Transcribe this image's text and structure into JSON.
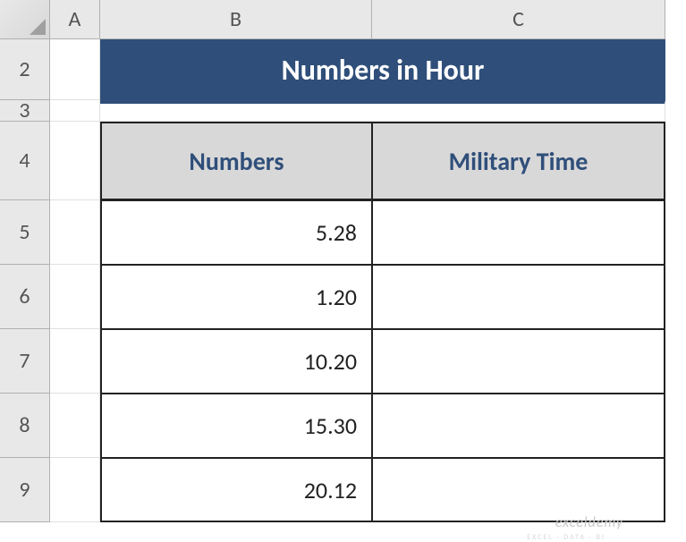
{
  "columns": [
    "A",
    "B",
    "C"
  ],
  "rows": [
    "2",
    "3",
    "4",
    "5",
    "6",
    "7",
    "8",
    "9"
  ],
  "title": "Numbers in Hour",
  "headers": {
    "col_b": "Numbers",
    "col_c": "Military Time"
  },
  "chart_data": {
    "type": "table",
    "columns": [
      "Numbers",
      "Military Time"
    ],
    "rows": [
      {
        "Numbers": "5.28",
        "Military Time": ""
      },
      {
        "Numbers": "1.20",
        "Military Time": ""
      },
      {
        "Numbers": "10.20",
        "Military Time": ""
      },
      {
        "Numbers": "15.30",
        "Military Time": ""
      },
      {
        "Numbers": "20.12",
        "Military Time": ""
      }
    ]
  },
  "watermark": "exceldemy",
  "watermark_sub": "EXCEL · DATA · BI"
}
